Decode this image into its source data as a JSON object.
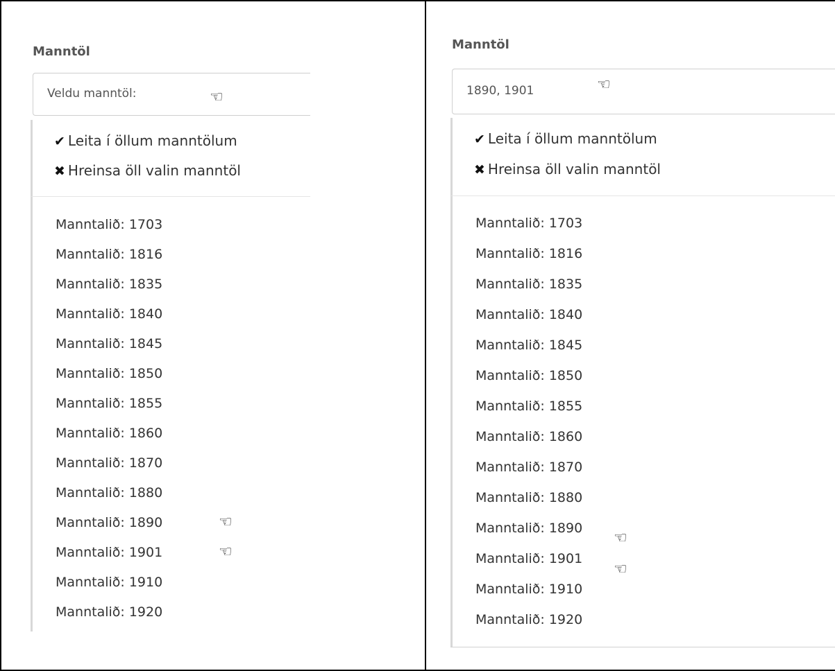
{
  "left": {
    "label": "Manntöl",
    "select_text": "Veldu manntöl:",
    "actions": [
      {
        "icon": "check-icon",
        "glyph": "✔",
        "label": "Leita í öllum manntölum"
      },
      {
        "icon": "x-icon",
        "glyph": "✖",
        "label": "Hreinsa öll valin manntöl"
      }
    ],
    "options": [
      "Manntalið: 1703",
      "Manntalið: 1816",
      "Manntalið: 1835",
      "Manntalið: 1840",
      "Manntalið: 1845",
      "Manntalið: 1850",
      "Manntalið: 1855",
      "Manntalið: 1860",
      "Manntalið: 1870",
      "Manntalið: 1880",
      "Manntalið: 1890",
      "Manntalið: 1901",
      "Manntalið: 1910",
      "Manntalið: 1920"
    ]
  },
  "right": {
    "label": "Manntöl",
    "select_text": "1890, 1901",
    "actions": [
      {
        "icon": "check-icon",
        "glyph": "✔",
        "label": "Leita í öllum manntölum"
      },
      {
        "icon": "x-icon",
        "glyph": "✖",
        "label": "Hreinsa öll valin manntöl"
      }
    ],
    "options": [
      "Manntalið: 1703",
      "Manntalið: 1816",
      "Manntalið: 1835",
      "Manntalið: 1840",
      "Manntalið: 1845",
      "Manntalið: 1850",
      "Manntalið: 1855",
      "Manntalið: 1860",
      "Manntalið: 1870",
      "Manntalið: 1880",
      "Manntalið: 1890",
      "Manntalið: 1901",
      "Manntalið: 1910",
      "Manntalið: 1920"
    ]
  },
  "pointer_glyph": "☜"
}
